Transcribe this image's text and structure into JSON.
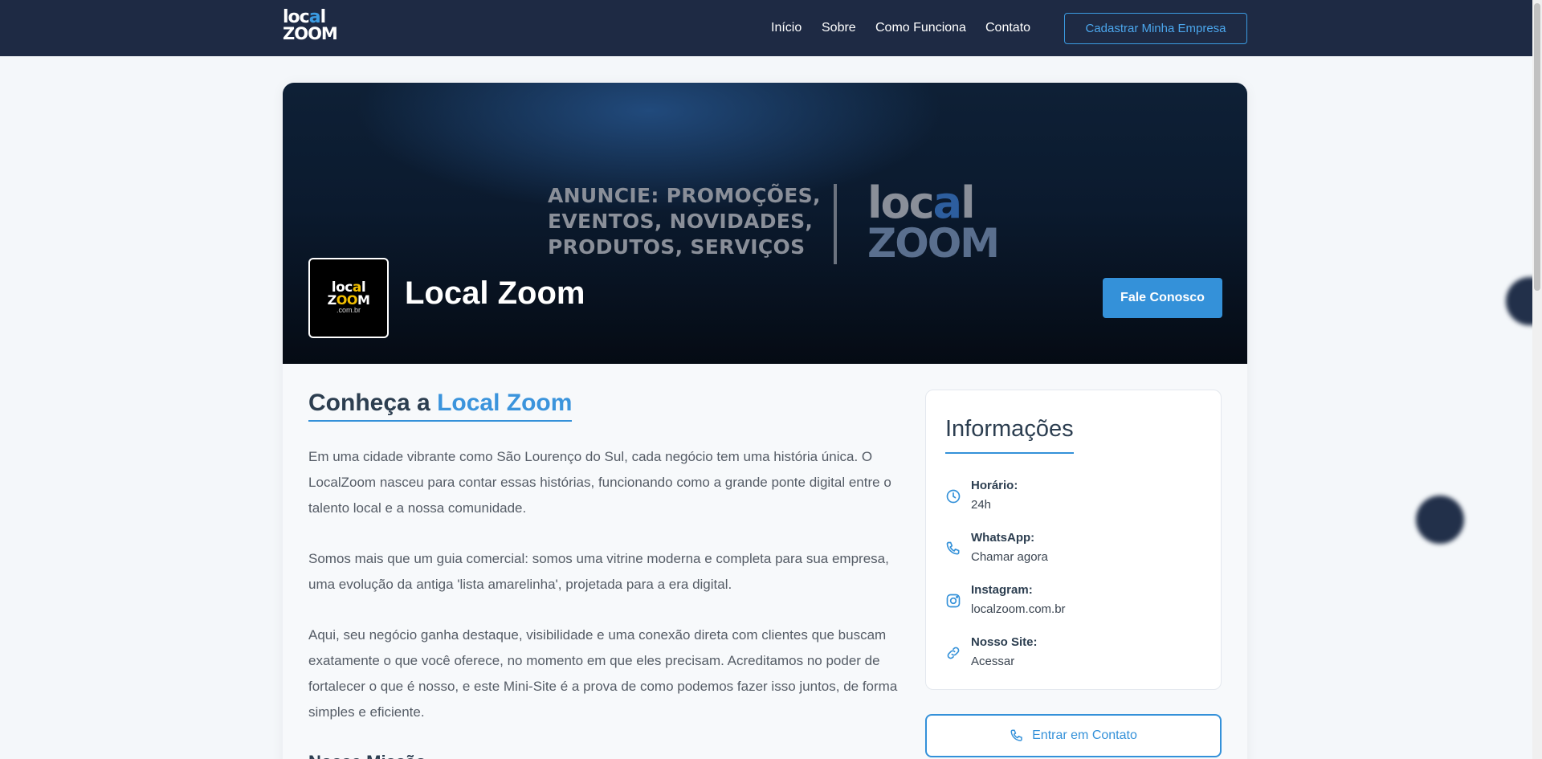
{
  "brand": {
    "line1_pre": "loc",
    "line1_accent": "a",
    "line1_post": "l",
    "line2": "ZOOM"
  },
  "nav": {
    "items": [
      {
        "label": "Início"
      },
      {
        "label": "Sobre"
      },
      {
        "label": "Como Funciona"
      },
      {
        "label": "Contato"
      }
    ],
    "cta_label": "Cadastrar Minha Empresa"
  },
  "hero": {
    "banner_lines": [
      "ANUNCIE: PROMOÇÕES,",
      "EVENTOS, NOVIDADES,",
      "PRODUTOS, SERVIÇOS"
    ],
    "banner_logo": {
      "line1_pre": "loc",
      "line1_accent": "a",
      "line1_post": "l",
      "line2": "ZOOM"
    },
    "avatar": {
      "line1_pre": "loc",
      "line1_accent": "a",
      "line1_post": "l",
      "line2_pre": "Z",
      "line2_accent": "OO",
      "line2_post": "M",
      "line3": ".com.br"
    },
    "company_name": "Local Zoom",
    "contact_button": "Fale Conosco"
  },
  "about": {
    "title_prefix": "Conheça a ",
    "title_highlight": "Local Zoom",
    "paragraphs": [
      "Em uma cidade vibrante como São Lourenço do Sul, cada negócio tem uma história única. O LocalZoom nasceu para contar essas histórias, funcionando como a grande ponte digital entre o talento local e a nossa comunidade.",
      "Somos mais que um guia comercial: somos uma vitrine moderna e completa para sua empresa, uma evolução da antiga 'lista amarelinha', projetada para a era digital.",
      "Aqui, seu negócio ganha destaque, visibilidade e uma conexão direta com clientes que buscam exatamente o que você oferece, no momento em que eles precisam. Acreditamos no poder de fortalecer o que é nosso, e este Mini-Site é a prova de como podemos fazer isso juntos, de forma simples e eficiente."
    ],
    "next_heading": "Nossa Missão"
  },
  "info": {
    "title": "Informações",
    "items": [
      {
        "label": "Horário:",
        "value": "24h",
        "icon": "clock-icon"
      },
      {
        "label": "WhatsApp:",
        "value": "Chamar agora",
        "icon": "phone-icon"
      },
      {
        "label": "Instagram:",
        "value": "localzoom.com.br",
        "icon": "instagram-icon"
      },
      {
        "label": "Nosso Site:",
        "value": "Acessar",
        "icon": "link-icon"
      }
    ],
    "contact_button": "Entrar em Contato"
  },
  "colors": {
    "nav_bg": "#1e2a44",
    "accent": "#3491d9",
    "text": "#2c3e50"
  }
}
